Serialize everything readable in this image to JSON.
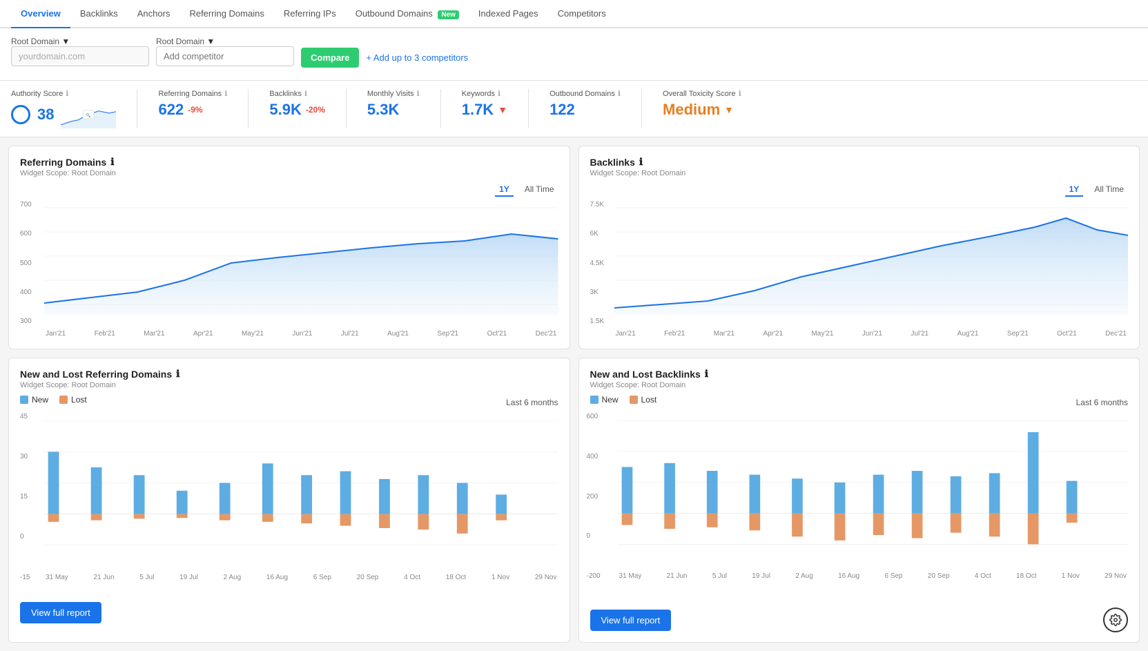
{
  "nav": {
    "tabs": [
      {
        "label": "Overview",
        "active": true,
        "badge": null
      },
      {
        "label": "Backlinks",
        "active": false,
        "badge": null
      },
      {
        "label": "Anchors",
        "active": false,
        "badge": null
      },
      {
        "label": "Referring Domains",
        "active": false,
        "badge": null
      },
      {
        "label": "Referring IPs",
        "active": false,
        "badge": null
      },
      {
        "label": "Outbound Domains",
        "active": false,
        "badge": "New"
      },
      {
        "label": "Indexed Pages",
        "active": false,
        "badge": null
      },
      {
        "label": "Competitors",
        "active": false,
        "badge": null
      }
    ]
  },
  "topbar": {
    "domain_label1": "Root Domain",
    "domain_label2": "Root Domain",
    "domain_placeholder": "yourdomain.com",
    "competitor_placeholder": "Add competitor",
    "compare_btn": "Compare",
    "add_competitor": "Add up to 3 competitors"
  },
  "metrics": [
    {
      "label": "Authority Score",
      "value": "38",
      "change": null,
      "type": "circle"
    },
    {
      "label": "Referring Domains",
      "value": "622",
      "change": "-9%",
      "type": "number"
    },
    {
      "label": "Backlinks",
      "value": "5.9K",
      "change": "-20%",
      "type": "number"
    },
    {
      "label": "Monthly Visits",
      "value": "5.3K",
      "change": null,
      "type": "number"
    },
    {
      "label": "Keywords",
      "value": "1.7K",
      "change": "down",
      "type": "number"
    },
    {
      "label": "Outbound Domains",
      "value": "122",
      "change": null,
      "type": "number"
    },
    {
      "label": "Overall Toxicity Score",
      "value": "Medium",
      "change": "dropdown",
      "type": "orange"
    }
  ],
  "charts": {
    "referring_domains": {
      "title": "Referring Domains",
      "subtitle": "Widget Scope: Root Domain",
      "period_active": "1Y",
      "periods": [
        "1Y",
        "All Time"
      ],
      "y_labels": [
        "700",
        "600",
        "500",
        "400",
        "300"
      ],
      "x_labels": [
        "Jan'21",
        "Feb'21",
        "Mar'21",
        "Apr'21",
        "May'21",
        "Jun'21",
        "Jul'21",
        "Aug'21",
        "Sep'21",
        "Oct'21",
        "Dec'21"
      ]
    },
    "backlinks": {
      "title": "Backlinks",
      "subtitle": "Widget Scope: Root Domain",
      "period_active": "1Y",
      "periods": [
        "1Y",
        "All Time"
      ],
      "y_labels": [
        "7.5K",
        "6K",
        "4.5K",
        "3K",
        "1.5K"
      ],
      "x_labels": [
        "Jan'21",
        "Feb'21",
        "Mar'21",
        "Apr'21",
        "May'21",
        "Jun'21",
        "Jul'21",
        "Aug'21",
        "Sep'21",
        "Oct'21",
        "Dec'21"
      ]
    },
    "new_lost_domains": {
      "title": "New and Lost Referring Domains",
      "subtitle": "Widget Scope: Root Domain",
      "period": "Last 6 months",
      "legend_new": "New",
      "legend_lost": "Lost",
      "y_labels": [
        "45",
        "30",
        "15",
        "0",
        "-15"
      ],
      "x_labels": [
        "31 May",
        "21 Jun",
        "5 Jul",
        "19 Jul",
        "2 Aug",
        "16 Aug",
        "6 Sep",
        "20 Sep",
        "4 Oct",
        "18 Oct",
        "1 Nov",
        "29 Nov"
      ],
      "view_report": "View full report"
    },
    "new_lost_backlinks": {
      "title": "New and Lost Backlinks",
      "subtitle": "Widget Scope: Root Domain",
      "period": "Last 6 months",
      "legend_new": "New",
      "legend_lost": "Lost",
      "y_labels": [
        "600",
        "400",
        "200",
        "0",
        "-200"
      ],
      "x_labels": [
        "31 May",
        "21 Jun",
        "5 Jul",
        "19 Jul",
        "2 Aug",
        "16 Aug",
        "6 Sep",
        "20 Sep",
        "4 Oct",
        "18 Oct",
        "1 Nov",
        "29 Nov"
      ],
      "view_report": "View full report"
    }
  },
  "colors": {
    "blue": "#1a73e8",
    "light_blue": "#b3d4f5",
    "orange": "#e67e22",
    "light_orange": "#f5c07a",
    "green": "#2ecc71",
    "red": "#e74c3c",
    "area_blue": "#d6eaf8",
    "bar_blue": "#5dade2",
    "bar_orange": "#e59866"
  }
}
